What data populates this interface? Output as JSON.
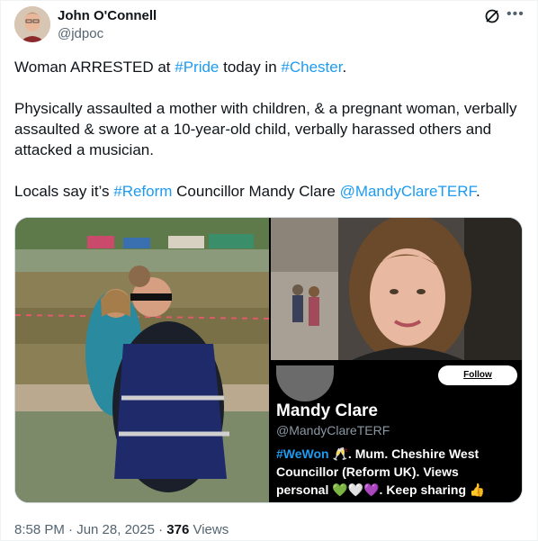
{
  "author": {
    "name": "John O'Connell",
    "handle": "@jdpoc"
  },
  "tweet": {
    "line1_pre": "Woman ARRESTED at ",
    "line1_tag1": "#Pride",
    "line1_mid": " today in ",
    "line1_tag2": "#Chester",
    "line1_post": ".",
    "paragraph2": "Physically assaulted a mother with children, & a pregnant woman, verbally assaulted & swore at a 10-year-old child, verbally harassed others and attacked a musician.",
    "line3_pre": "Locals say it’s ",
    "line3_tag": "#Reform",
    "line3_mid": " Councillor Mandy Clare ",
    "line3_mention": "@MandyClareTERF",
    "line3_post": "."
  },
  "profile_card": {
    "follow_label": "Follow",
    "name": "Mandy Clare",
    "handle": "@MandyClareTERF",
    "bio_tag": "#WeWon",
    "bio_line1": " 🥂. Mum. Cheshire West",
    "bio_line2": "Councillor (Reform UK). Views",
    "bio_line3": "personal 💚🤍💜. Keep sharing 👍"
  },
  "meta": {
    "time": "8:58 PM · Jun 28, 2025 · ",
    "views_count": "376",
    "views_label": " Views"
  },
  "icons": {
    "grok": "grok-icon",
    "more": "more-icon"
  },
  "colors": {
    "link": "#1d9bf0",
    "muted": "#536471"
  }
}
